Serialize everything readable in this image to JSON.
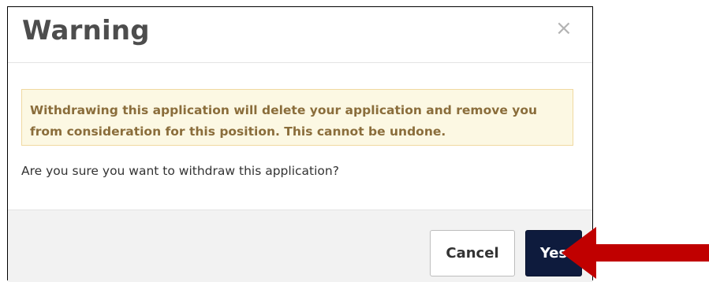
{
  "dialog": {
    "title": "Warning",
    "close_glyph": "×",
    "alert_line1": "Withdrawing this application will delete your application and remove you",
    "alert_line2": "from consideration for this position. This cannot be undone.",
    "question": "Are you sure you want to withdraw this application?",
    "cancel_label": "Cancel",
    "yes_label": "Yes"
  },
  "colors": {
    "alert_bg": "#fcf8e3",
    "alert_text": "#8a6d3b",
    "yes_button": "#0e1b3d",
    "arrow": "#c00000"
  },
  "icons": [
    "close-icon",
    "pointer-arrow-icon"
  ]
}
